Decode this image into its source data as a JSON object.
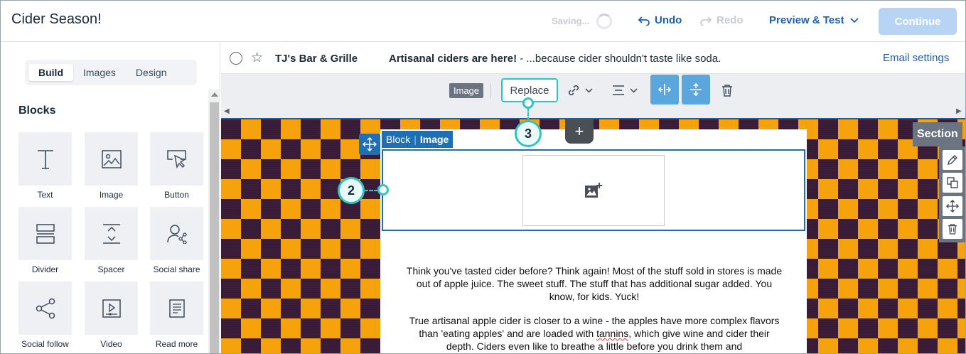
{
  "header": {
    "title": "Cider Season!",
    "saving": "Saving...",
    "undo": "Undo",
    "redo": "Redo",
    "preview": "Preview & Test",
    "continue": "Continue"
  },
  "sidebar": {
    "tabs": [
      {
        "label": "Build",
        "active": true
      },
      {
        "label": "Images",
        "active": false
      },
      {
        "label": "Design",
        "active": false
      }
    ],
    "blocks_heading": "Blocks",
    "blocks": [
      {
        "label": "Text",
        "icon": "text-icon"
      },
      {
        "label": "Image",
        "icon": "image-icon"
      },
      {
        "label": "Button",
        "icon": "button-icon"
      },
      {
        "label": "Divider",
        "icon": "divider-icon"
      },
      {
        "label": "Spacer",
        "icon": "spacer-icon"
      },
      {
        "label": "Social share",
        "icon": "social-share-icon"
      },
      {
        "label": "Social follow",
        "icon": "social-follow-icon"
      },
      {
        "label": "Video",
        "icon": "video-icon"
      },
      {
        "label": "Read more",
        "icon": "read-more-icon"
      }
    ]
  },
  "email": {
    "from": "TJ's Bar & Grille",
    "subject_bold": "Artisanal ciders are here!",
    "subject_rest": " - ...because cider shouldn't taste like soda.",
    "settings_link": "Email settings"
  },
  "toolbar": {
    "tag": "Image",
    "replace": "Replace"
  },
  "canvas": {
    "add": "+",
    "block_tag_left": "Block",
    "block_tag_sep": "|",
    "block_tag_right": "Image",
    "section_label": "Section",
    "paragraph1": "Think you've tasted cider before? Think again! Most of the stuff sold in stores is made out of apple juice. The sweet stuff. The stuff that has additional sugar added. You know, for kids. Yuck!",
    "paragraph2_a": "True artisanal apple cider is closer to a wine - the apples have more complex flavors than 'eating apples' and are loaded with ",
    "paragraph2_flag": "tannins",
    "paragraph2_b": ", which give wine and cider their depth. Ciders even like to breathe a little before you drink them and"
  },
  "callouts": {
    "two": "2",
    "three": "3"
  },
  "colors": {
    "primary_blue": "#1a5fb4",
    "selection_blue": "#1f6fb5",
    "callout_teal": "#2fc4c4",
    "plaid_orange": "#f5a20c",
    "plaid_plum": "#3d1e3a"
  }
}
